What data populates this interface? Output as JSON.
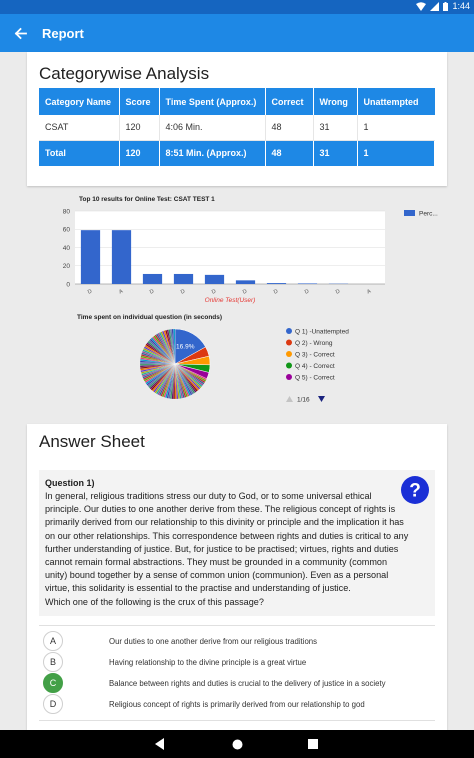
{
  "status_bar": {
    "time": "1:44"
  },
  "app_bar": {
    "title": "Report"
  },
  "category": {
    "title": "Categorywise Analysis",
    "headers": [
      "Category Name",
      "Score",
      "Time Spent (Approx.)",
      "Correct",
      "Wrong",
      "Unattempted"
    ],
    "rows": [
      [
        "CSAT",
        "120",
        "4:06 Min.",
        "48",
        "31",
        "1"
      ]
    ],
    "total": [
      "Total",
      "120",
      "8:51 Min. (Approx.)",
      "48",
      "31",
      "1"
    ]
  },
  "chart_data": [
    {
      "type": "bar",
      "title": "Top 10 results for Online Test: CSAT TEST 1",
      "xlabel": "Online Test(User)",
      "ylabel": "",
      "ylim": [
        0,
        80
      ],
      "yticks": [
        0,
        20,
        40,
        60,
        80
      ],
      "categories": [
        "D",
        "A",
        "D",
        "D",
        "D",
        "D",
        "D",
        "D",
        "D",
        "A"
      ],
      "series": [
        {
          "name": "Perc...",
          "values": [
            59,
            59,
            11,
            11,
            10,
            4,
            1,
            0.6,
            0.3,
            0
          ]
        }
      ],
      "grid": true,
      "legend": "top-right",
      "colors": {
        "bar": "#3366cc",
        "xlabel": "#e53935"
      }
    },
    {
      "type": "pie",
      "title": "Time spent on individual question (in seconds)",
      "slice_label": "16.9%",
      "series": [
        {
          "name": "Q 1) -Unattempted",
          "value": 16.9,
          "color": "#3366cc"
        },
        {
          "name": "Q 2) - Wrong",
          "value": 4.5,
          "color": "#dc3912"
        },
        {
          "name": "Q 3) - Correct",
          "value": 4.0,
          "color": "#ff9900"
        },
        {
          "name": "Q 4) - Correct",
          "value": 3.5,
          "color": "#109618"
        },
        {
          "name": "Q 5) - Correct",
          "value": 3.0,
          "color": "#990099"
        }
      ],
      "legend": "right",
      "pager": "1/16"
    }
  ],
  "answer_sheet": {
    "title": "Answer Sheet",
    "question_label": "Question 1)",
    "question_lines": [
      "In general, religious traditions stress our duty to God, or to some universal ethical",
      "principle. Our duties to one another derive from these. The religious concept of rights is",
      "primarily derived from our relationship to this divinity or principle and the implication it has",
      "on our other relationships. This correspondence between rights and duties is critical to any",
      "further understanding of justice. But, for justice to be practised; virtues, rights and duties",
      "cannot remain formal abstractions. They must be grounded in a community (common",
      "unity) bound together by a sense of common union (communion). Even as a personal",
      "virtue, this solidarity is essential to the practise and understanding of justice.",
      "Which one of the following is the crux of this passage?"
    ],
    "options": [
      {
        "letter": "A",
        "text": "Our duties to one another derive from our religious traditions",
        "correct": false
      },
      {
        "letter": "B",
        "text": "Having relationship to the divine principle is a great virtue",
        "correct": false
      },
      {
        "letter": "C",
        "text": "Balance between rights and duties is crucial to the delivery of justice in a society",
        "correct": true
      },
      {
        "letter": "D",
        "text": "Religious concept of rights is primarily derived from our relationship to god",
        "correct": false
      }
    ]
  },
  "colors": {
    "primary": "#1e88e5",
    "status_bar": "#1565c0",
    "correct": "#43a047"
  }
}
